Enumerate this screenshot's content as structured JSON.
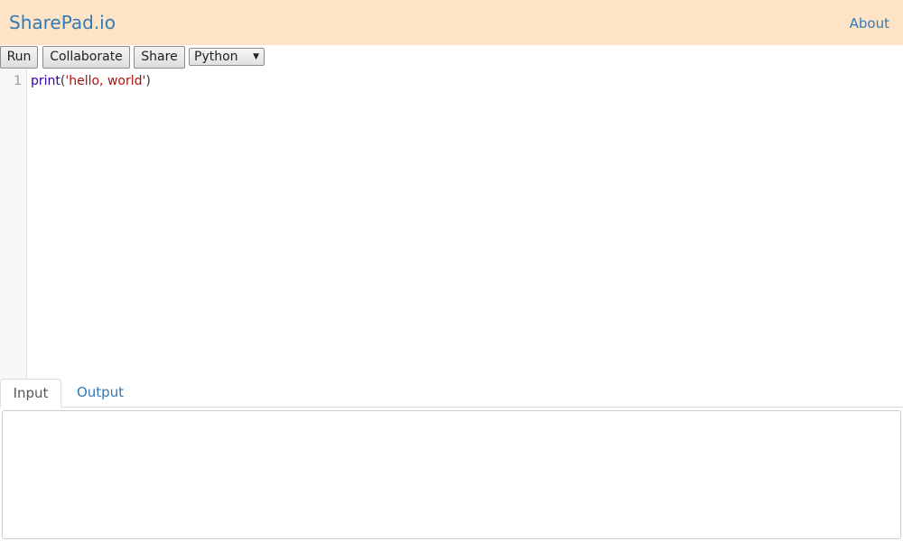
{
  "header": {
    "brand": "SharePad.io",
    "about_label": "About",
    "background_color": "#fde4c6",
    "link_color": "#337ab7"
  },
  "toolbar": {
    "run_label": "Run",
    "collaborate_label": "Collaborate",
    "share_label": "Share",
    "language_selected": "Python",
    "language_arrow_icon": "dropdown-arrow-icon"
  },
  "editor": {
    "lines": [
      {
        "number": "1",
        "tokens": {
          "builtin": "print",
          "open_paren": "(",
          "string": "'hello, world'",
          "close_paren": ")"
        }
      }
    ]
  },
  "tabs": {
    "input_label": "Input",
    "output_label": "Output",
    "active": "Input"
  },
  "input_panel": {
    "value": "",
    "placeholder": ""
  }
}
